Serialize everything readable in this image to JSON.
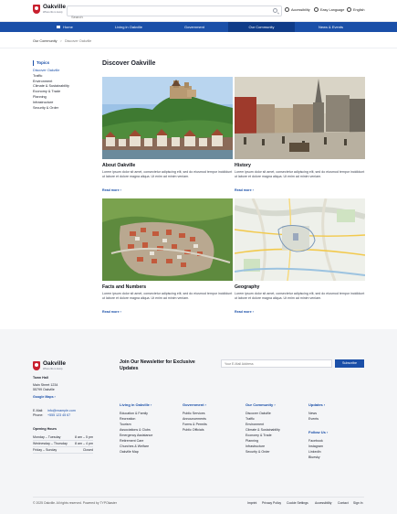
{
  "header": {
    "logo_name": "Oakville",
    "logo_tagline": "Where life is lovely",
    "search_placeholder": "Search",
    "accessibility": "Accessibility",
    "easy_language": "Easy Language",
    "language": "English"
  },
  "nav": [
    "Home",
    "Living in Oakville",
    "Government",
    "Our Community",
    "News & Events"
  ],
  "breadcrumb": {
    "parent": "Our Community",
    "separator": ">",
    "current": "Discover Oakville"
  },
  "sidebar": {
    "heading": "Topics",
    "items": [
      "Discover Oakville",
      "Traffic",
      "Environment",
      "Climate & Sustainability",
      "Economy & Trade",
      "Planning",
      "Infrastructure",
      "Security & Order"
    ]
  },
  "main": {
    "title": "Discover Oakville",
    "cards": [
      {
        "title": "About Oakville",
        "text": "Lorem ipsum dolor sit amet, consectetur adipiscing elit, sed do eiusmod tempor incididunt ut labore et dolore magna aliqua. Ut enim ad minim veniam.",
        "more": "Read more ›"
      },
      {
        "title": "History",
        "text": "Lorem ipsum dolor sit amet, consectetur adipiscing elit, sed do eiusmod tempor incididunt ut labore et dolore magna aliqua. Ut enim ad minim veniam.",
        "more": "Read more ›"
      },
      {
        "title": "Facts and Numbers",
        "text": "Lorem ipsum dolor sit amet, consectetur adipiscing elit, sed do eiusmod tempor incididunt ut labore et dolore magna aliqua. Ut enim ad minim veniam.",
        "more": "Read more ›"
      },
      {
        "title": "Geography",
        "text": "Lorem ipsum dolor sit amet, consectetur adipiscing elit, sed do eiusmod tempor incididunt ut labore et dolore magna aliqua. Ut enim ad minim veniam.",
        "more": "Read more ›"
      }
    ]
  },
  "footer": {
    "logo_name": "Oakville",
    "logo_tagline": "Where life is lovely",
    "newsletter_title": "Join Our Newsletter for Exclusive Updates",
    "newsletter_placeholder": "Your E-Mail Address",
    "subscribe": "Subscribe",
    "town_hall": "Town Hall",
    "address_1": "Main Street 1234",
    "address_2": "55799 Oakville",
    "google_maps": "Google Maps ›",
    "email_label": "E-Mail:",
    "email": "info@example.com",
    "phone_label": "Phone:",
    "phone": "+555 123 45 67",
    "opening_hours": "Opening Hours",
    "hours": [
      {
        "days": "Monday – Tuesday",
        "time": "8 am – 5 pm"
      },
      {
        "days": "Wednesday – Thursday",
        "time": "8 am – 4 pm"
      },
      {
        "days": "Friday – Sunday",
        "time": "Closed"
      }
    ],
    "columns": [
      {
        "heading": "Living in Oakville ›",
        "items": [
          "Education & Family",
          "Recreation",
          "Tourism",
          "Associations & Clubs",
          "Emergency Assistance",
          "Retirement Care",
          "Churches & Welfare",
          "Oakville Map"
        ]
      },
      {
        "heading": "Government ›",
        "items": [
          "Public Services",
          "Announcements",
          "Forms & Permits",
          "Public Officials"
        ]
      },
      {
        "heading": "Our Community ›",
        "items": [
          "Discover Oakville",
          "Traffic",
          "Environment",
          "Climate & Sustainability",
          "Economy & Trade",
          "Planning",
          "Infrastructure",
          "Security & Order"
        ]
      },
      {
        "heading": "Updates ›",
        "items": [
          "News",
          "Events"
        ]
      }
    ],
    "follow_us": "Follow Us ›",
    "social": [
      "Facebook",
      "Instagram",
      "LinkedIn",
      "Bluesky"
    ],
    "copyright": "© 2025 Oakville. All rights reserved. Powered by TYPOkaster",
    "legal": [
      "Imprint",
      "Privacy Policy",
      "Cookie Settings",
      "Accessibility",
      "Contact",
      "Sign In"
    ]
  },
  "colors": {
    "brand": "#1a4fa8",
    "nav_active": "#0f3b88",
    "crest": "#c8202f",
    "footer_bg": "#f4f5f7"
  }
}
